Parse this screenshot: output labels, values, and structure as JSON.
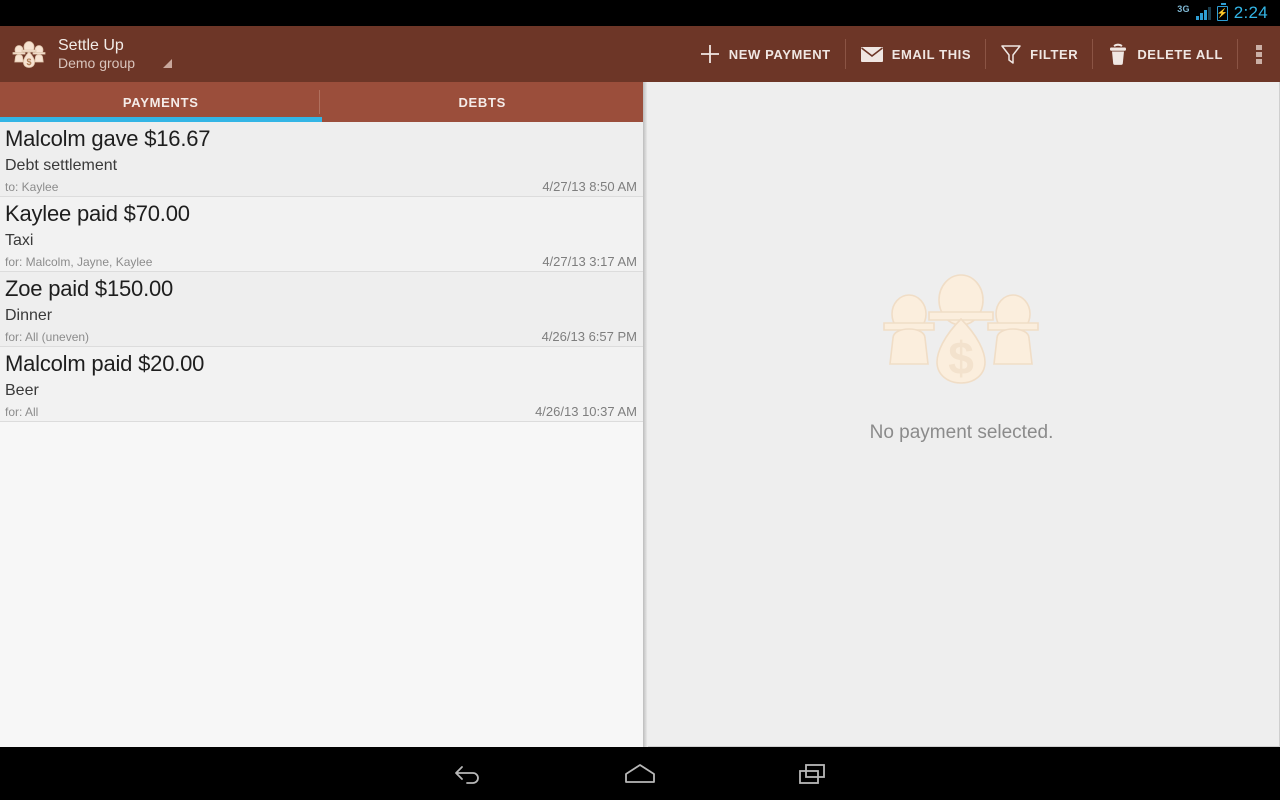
{
  "statusbar": {
    "network": "3G",
    "battery_icon": "battery-charging-icon",
    "signal_icon": "signal-bars-icon",
    "time": "2:24"
  },
  "actionbar": {
    "logo_icon": "settle-up-group-logo-icon",
    "app_title": "Settle Up",
    "group_name": "Demo group",
    "spinner_icon": "dropdown-triangle-icon",
    "buttons": [
      {
        "label": "NEW PAYMENT",
        "icon": "plus-icon"
      },
      {
        "label": "EMAIL THIS",
        "icon": "envelope-icon"
      },
      {
        "label": "FILTER",
        "icon": "funnel-icon"
      },
      {
        "label": "DELETE ALL",
        "icon": "trash-icon"
      }
    ],
    "overflow_icon": "overflow-menu-icon"
  },
  "tabs": [
    {
      "label": "PAYMENTS",
      "active": true
    },
    {
      "label": "DEBTS",
      "active": false
    }
  ],
  "payments": [
    {
      "title": "Malcolm gave $16.67",
      "description": "Debt settlement",
      "participants": "to: Kaylee",
      "date": "4/27/13 8:50 AM"
    },
    {
      "title": "Kaylee paid $70.00",
      "description": "Taxi",
      "participants": "for: Malcolm, Jayne, Kaylee",
      "date": "4/27/13 3:17 AM"
    },
    {
      "title": "Zoe paid $150.00",
      "description": "Dinner",
      "participants": "for: All (uneven)",
      "date": "4/26/13 6:57 PM"
    },
    {
      "title": "Malcolm paid $20.00",
      "description": "Beer",
      "participants": "for: All",
      "date": "4/26/13 10:37 AM"
    }
  ],
  "detail": {
    "watermark_icon": "settle-up-group-watermark-icon",
    "empty_text": "No payment selected."
  },
  "navbar": [
    {
      "icon": "back-icon"
    },
    {
      "icon": "home-icon"
    },
    {
      "icon": "recents-icon"
    }
  ],
  "colors": {
    "action_bar": "#6d3627",
    "tab_bar": "#9b4e3b",
    "accent": "#33b5e5",
    "list_bg": "#f2f2f2",
    "detail_bg": "#eeeeee",
    "watermark": "#faebd7"
  }
}
